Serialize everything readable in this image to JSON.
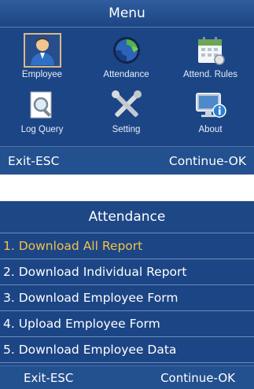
{
  "menu_screen": {
    "title": "Menu",
    "items": [
      {
        "label": "Employee",
        "icon": "employee-icon"
      },
      {
        "label": "Attendance",
        "icon": "attendance-icon"
      },
      {
        "label": "Attend. Rules",
        "icon": "calendar-icon"
      },
      {
        "label": "Log Query",
        "icon": "log-query-icon"
      },
      {
        "label": "Setting",
        "icon": "setting-icon"
      },
      {
        "label": "About",
        "icon": "about-icon"
      }
    ],
    "exit_label": "Exit-ESC",
    "continue_label": "Continue-OK"
  },
  "attendance_screen": {
    "title": "Attendance",
    "items": [
      {
        "label": "1. Download All Report"
      },
      {
        "label": "2. Download Individual Report"
      },
      {
        "label": "3. Download Employee Form"
      },
      {
        "label": "4. Upload Employee Form"
      },
      {
        "label": "5. Download Employee Data"
      }
    ],
    "exit_label": "Exit-ESC",
    "continue_label": "Continue-OK"
  },
  "colors": {
    "screen_background": "#1c4585",
    "highlight_text": "#f2c24a",
    "selection_border": "#d8b98a"
  }
}
